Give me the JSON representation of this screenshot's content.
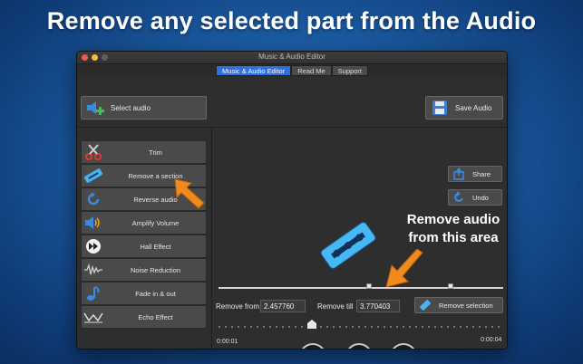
{
  "headline": "Remove any selected part from the Audio",
  "window": {
    "title": "Music & Audio Editor",
    "tabs": [
      {
        "label": "Music & Audio Editor",
        "active": true
      },
      {
        "label": "Read Me",
        "active": false
      },
      {
        "label": "Support",
        "active": false
      }
    ]
  },
  "toolbar": {
    "select_audio_label": "Select audio",
    "save_audio_label": "Save Audio"
  },
  "tools": [
    {
      "label": "Trim",
      "icon": "scissors-icon"
    },
    {
      "label": "Remove a section",
      "icon": "razor-blade-icon"
    },
    {
      "label": "Reverse audio",
      "icon": "reverse-icon"
    },
    {
      "label": "Amplify Volume",
      "icon": "speaker-icon"
    },
    {
      "label": "Hall Effect",
      "icon": "fast-forward-icon"
    },
    {
      "label": "Noise Reduction",
      "icon": "waveform-icon"
    },
    {
      "label": "Fade in & out",
      "icon": "music-note-icon"
    },
    {
      "label": "Echo Effect",
      "icon": "echo-icon"
    }
  ],
  "actions": {
    "share_label": "Share",
    "undo_label": "Undo",
    "remove_selection_label": "Remove selection"
  },
  "annotation": {
    "line1": "Remove audio",
    "line2": "from this area"
  },
  "range": {
    "remove_from_label": "Remove from",
    "remove_from_value": "2.457760",
    "remove_till_label": "Remove till",
    "remove_till_value": "3.770403"
  },
  "player": {
    "start_time": "0:00:01",
    "end_time": "0:00:04"
  },
  "colors": {
    "accent": "#2f6fe0",
    "arrow": "#f08a1d",
    "background": "#1b5aa0"
  }
}
